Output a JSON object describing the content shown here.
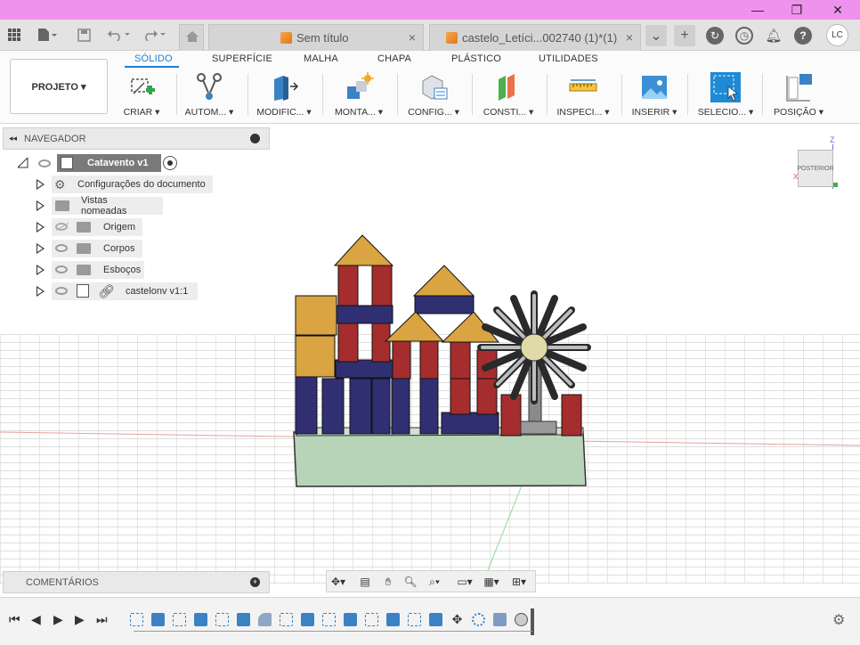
{
  "window": {
    "controls": {
      "minimize": "—",
      "maximize": "❐",
      "close": "✕"
    }
  },
  "tabs": [
    {
      "label": "Sem título",
      "close": "×"
    },
    {
      "label": "castelo_Letíci...002740 (1)*(1)",
      "close": "×"
    }
  ],
  "user": {
    "initials": "LC"
  },
  "toolbar": {
    "projeto": "PROJETO ▾",
    "ribbon_tabs": [
      "SÓLIDO",
      "SUPERFÍCIE",
      "MALHA",
      "CHAPA",
      "PLÁSTICO",
      "UTILIDADES"
    ],
    "tools": [
      {
        "label": "CRIAR ▾",
        "icon": "create-sketch-icon"
      },
      {
        "label": "AUTOM... ▾",
        "icon": "automate-icon"
      },
      {
        "label": "MODIFIC... ▾",
        "icon": "modify-icon"
      },
      {
        "label": "MONTA... ▾",
        "icon": "assemble-icon"
      },
      {
        "label": "CONFIG... ▾",
        "icon": "configure-icon"
      },
      {
        "label": "CONSTI... ▾",
        "icon": "construct-icon"
      },
      {
        "label": "INSPECI... ▾",
        "icon": "inspect-icon"
      },
      {
        "label": "INSERIR ▾",
        "icon": "insert-image-icon"
      },
      {
        "label": "SELECIO... ▾",
        "icon": "select-icon"
      },
      {
        "label": "POSIÇÃO ▾",
        "icon": "position-icon"
      }
    ]
  },
  "navigator": {
    "title": "NAVEGADOR",
    "root": "Catavento v1",
    "items": [
      "Configurações do documento",
      "Vistas nomeadas",
      "Origem",
      "Corpos",
      "Esboços",
      "castelonv v1:1"
    ]
  },
  "viewcube": {
    "face": "POSTERIOR",
    "z": "Z",
    "x": "X"
  },
  "comments": {
    "title": "COMENTÁRIOS"
  },
  "colors": {
    "titlebar": "#ee92ee",
    "accent": "#1e7fd0",
    "tower_red": "#a52a2a",
    "block_navy": "#2c2c6e",
    "roof": "#d9a441",
    "base_green": "#b3d1b3"
  }
}
